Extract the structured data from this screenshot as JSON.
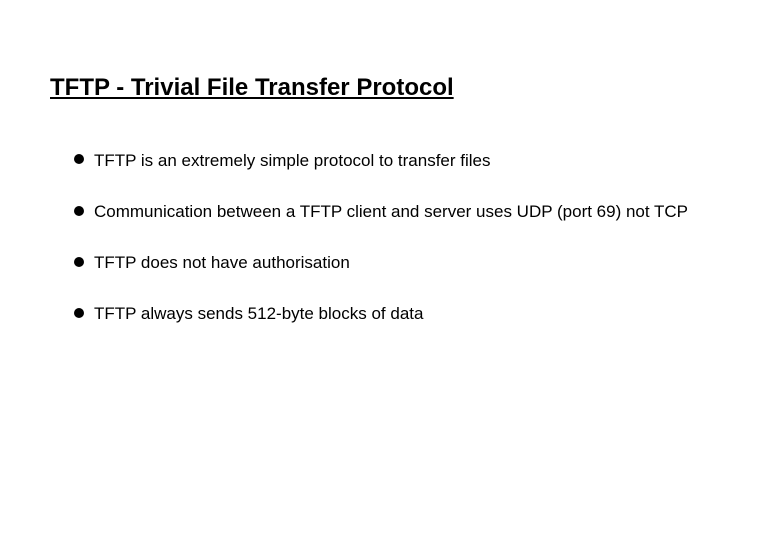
{
  "slide": {
    "title": "TFTP - Trivial File Transfer Protocol",
    "bullets": [
      "TFTP is an extremely simple protocol to transfer files",
      "Communication between a TFTP client and server uses UDP (port 69) not TCP",
      "TFTP does not have authorisation",
      "TFTP always sends 512-byte blocks of data"
    ]
  }
}
